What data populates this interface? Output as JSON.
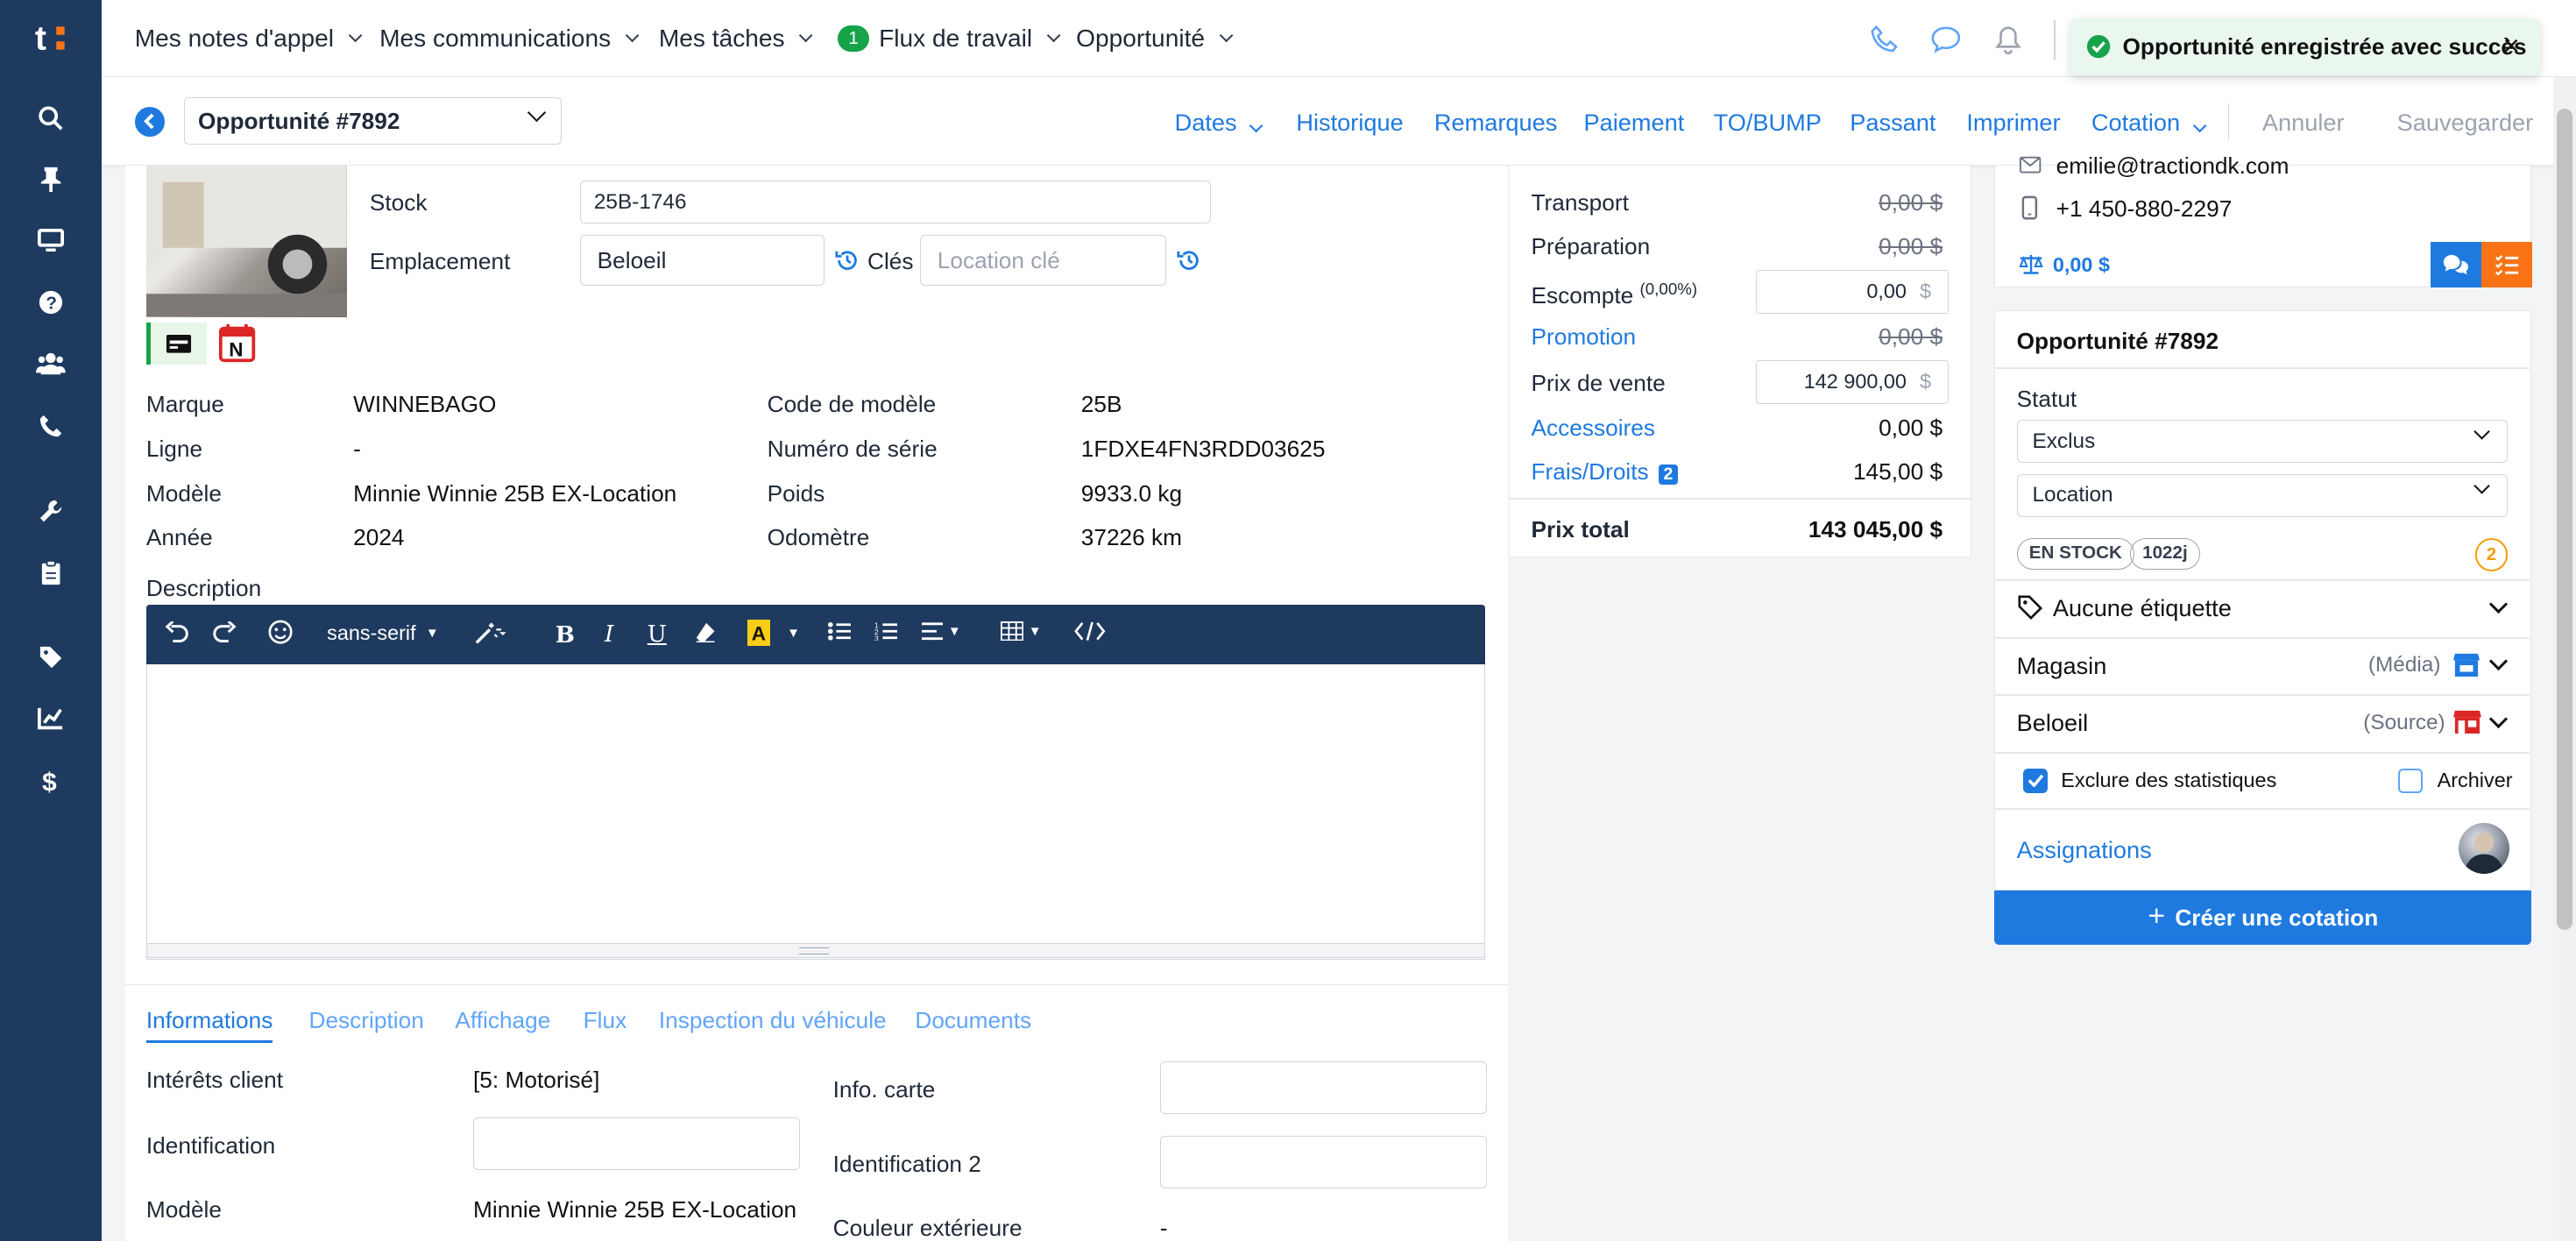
{
  "nav": {
    "menus": [
      {
        "label": "Mes notes d'appel"
      },
      {
        "label": "Mes communications"
      },
      {
        "label": "Mes tâches"
      },
      {
        "label": "Flux de travail",
        "badge": "1"
      },
      {
        "label": "Opportunité"
      }
    ]
  },
  "toast": {
    "message": "Opportunité enregistrée avec succès",
    "close": "✕"
  },
  "subbar": {
    "opportunity_select": "Opportunité #7892",
    "actions": {
      "dates": "Dates",
      "historique": "Historique",
      "remarques": "Remarques",
      "paiement": "Paiement",
      "to_bump": "TO/BUMP",
      "passant": "Passant",
      "imprimer": "Imprimer",
      "cotation": "Cotation",
      "annuler": "Annuler",
      "sauvegarder": "Sauvegarder"
    }
  },
  "vehicle": {
    "stock_label": "Stock",
    "stock_value": "25B-1746",
    "location_label": "Emplacement",
    "location_value": "Beloeil",
    "keys_label": "Clés",
    "keys_placeholder": "Location clé",
    "specs_left": [
      {
        "label": "Marque",
        "value": "WINNEBAGO"
      },
      {
        "label": "Ligne",
        "value": "-"
      },
      {
        "label": "Modèle",
        "value": "Minnie Winnie 25B EX-Location"
      },
      {
        "label": "Année",
        "value": "2024"
      }
    ],
    "specs_right": [
      {
        "label": "Code de modèle",
        "value": "25B"
      },
      {
        "label": "Numéro de série",
        "value": "1FDXE4FN3RDD03625"
      },
      {
        "label": "Poids",
        "value": "9933.0 kg"
      },
      {
        "label": "Odomètre",
        "value": "37226 km"
      }
    ],
    "description_label": "Description",
    "editor_font": "sans-serif"
  },
  "tabs": [
    "Informations",
    "Description",
    "Affichage",
    "Flux",
    "Inspection du véhicule",
    "Documents"
  ],
  "info": {
    "interets_label": "Intérêts client",
    "interets_value": "[5: Motorisé]",
    "identification_label": "Identification",
    "modele_label": "Modèle",
    "modele_value": "Minnie Winnie 25B EX-Location",
    "info_carte_label": "Info. carte",
    "identification2_label": "Identification 2",
    "couleur_label": "Couleur extérieure",
    "couleur_value": "-"
  },
  "pricing": {
    "transport": {
      "label": "Transport",
      "value": "0,00 $"
    },
    "preparation": {
      "label": "Préparation",
      "value": "0,00 $"
    },
    "escompte": {
      "label": "Escompte",
      "pct": "(0,00%)",
      "value": "0,00",
      "unit": "$"
    },
    "promotion": {
      "label": "Promotion",
      "value": "0,00 $"
    },
    "prix_vente": {
      "label": "Prix de vente",
      "value": "142 900,00",
      "unit": "$"
    },
    "accessoires": {
      "label": "Accessoires",
      "value": "0,00 $"
    },
    "frais": {
      "label": "Frais/Droits",
      "badge": "2",
      "value": "145,00 $"
    },
    "total": {
      "label": "Prix total",
      "value": "143 045,00 $"
    }
  },
  "contact": {
    "email": "emilie@tractiondk.com",
    "phone": "+1 450-880-2297",
    "balance": "0,00 $"
  },
  "card": {
    "title": "Opportunité #7892",
    "statut_label": "Statut",
    "statut_value": "Exclus",
    "type_value": "Location",
    "pill_stock": "EN STOCK",
    "pill_days": "1022j",
    "count_badge": "2",
    "etiquette": "Aucune étiquette",
    "magasin_label": "Magasin",
    "magasin_sub": "(Média)",
    "beloeil_label": "Beloeil",
    "beloeil_sub": "(Source)",
    "exclure_label": "Exclure des statistiques",
    "archiver_label": "Archiver",
    "assignations_label": "Assignations",
    "create_button": "Créer une cotation"
  },
  "colors": {
    "brand": "#1f7ae0",
    "sidebar": "#1e3a5f",
    "orange": "#f97316",
    "success": "#16a34a"
  }
}
